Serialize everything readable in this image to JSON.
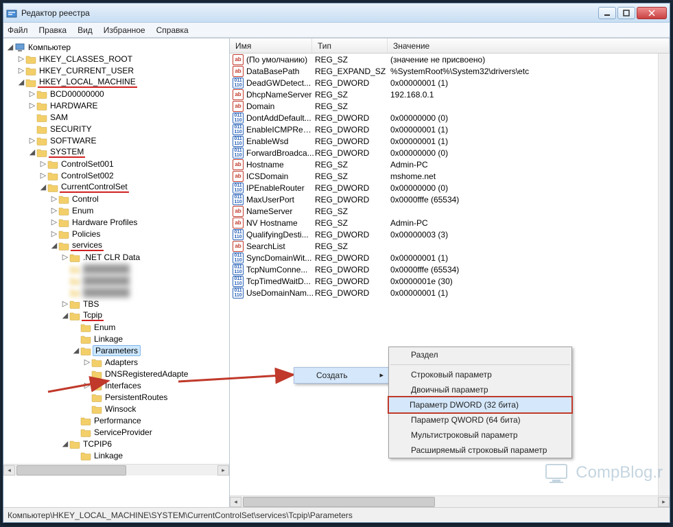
{
  "window": {
    "title": "Редактор реестра"
  },
  "menu": {
    "file": "Файл",
    "edit": "Правка",
    "view": "Вид",
    "fav": "Избранное",
    "help": "Справка"
  },
  "cols": {
    "name": "Имя",
    "type": "Тип",
    "value": "Значение"
  },
  "tree_root": "Компьютер",
  "hives": {
    "hkcr": "HKEY_CLASSES_ROOT",
    "hkcu": "HKEY_CURRENT_USER",
    "hklm": "HKEY_LOCAL_MACHINE"
  },
  "hklm_children": [
    "BCD00000000",
    "HARDWARE",
    "SAM",
    "SECURITY",
    "SOFTWARE",
    "SYSTEM"
  ],
  "system_children": [
    "ControlSet001",
    "ControlSet002",
    "CurrentControlSet"
  ],
  "ccs_children": [
    "Control",
    "Enum",
    "Hardware Profiles",
    "Policies",
    "services"
  ],
  "services_children": [
    ".NET CLR Data"
  ],
  "blurred": [
    "",
    "",
    ""
  ],
  "services_more": [
    "TBS",
    "Tcpip"
  ],
  "tcpip_children": [
    "Enum",
    "Linkage",
    "Parameters"
  ],
  "params_children": [
    "Adapters",
    "DNSRegisteredAdapte",
    "Interfaces",
    "PersistentRoutes",
    "Winsock"
  ],
  "tcpip_more": [
    "Performance",
    "ServiceProvider"
  ],
  "tcpip6": "TCPIP6",
  "tcpip6_children": [
    "Linkage"
  ],
  "values": [
    {
      "n": "(По умолчанию)",
      "t": "REG_SZ",
      "v": "(значение не присвоено)",
      "k": "ab"
    },
    {
      "n": "DataBasePath",
      "t": "REG_EXPAND_SZ",
      "v": "%SystemRoot%\\System32\\drivers\\etc",
      "k": "ab"
    },
    {
      "n": "DeadGWDetect...",
      "t": "REG_DWORD",
      "v": "0x00000001 (1)",
      "k": "bin"
    },
    {
      "n": "DhcpNameServer",
      "t": "REG_SZ",
      "v": "192.168.0.1",
      "k": "ab"
    },
    {
      "n": "Domain",
      "t": "REG_SZ",
      "v": "",
      "k": "ab"
    },
    {
      "n": "DontAddDefault...",
      "t": "REG_DWORD",
      "v": "0x00000000 (0)",
      "k": "bin"
    },
    {
      "n": "EnableICMPRedi...",
      "t": "REG_DWORD",
      "v": "0x00000001 (1)",
      "k": "bin"
    },
    {
      "n": "EnableWsd",
      "t": "REG_DWORD",
      "v": "0x00000001 (1)",
      "k": "bin"
    },
    {
      "n": "ForwardBroadca...",
      "t": "REG_DWORD",
      "v": "0x00000000 (0)",
      "k": "bin"
    },
    {
      "n": "Hostname",
      "t": "REG_SZ",
      "v": "Admin-PC",
      "k": "ab"
    },
    {
      "n": "ICSDomain",
      "t": "REG_SZ",
      "v": "mshome.net",
      "k": "ab"
    },
    {
      "n": "IPEnableRouter",
      "t": "REG_DWORD",
      "v": "0x00000000 (0)",
      "k": "bin"
    },
    {
      "n": "MaxUserPort",
      "t": "REG_DWORD",
      "v": "0x0000fffe (65534)",
      "k": "bin"
    },
    {
      "n": "NameServer",
      "t": "REG_SZ",
      "v": "",
      "k": "ab"
    },
    {
      "n": "NV Hostname",
      "t": "REG_SZ",
      "v": "Admin-PC",
      "k": "ab"
    },
    {
      "n": "QualifyingDesti...",
      "t": "REG_DWORD",
      "v": "0x00000003 (3)",
      "k": "bin"
    },
    {
      "n": "SearchList",
      "t": "REG_SZ",
      "v": "",
      "k": "ab"
    },
    {
      "n": "SyncDomainWit...",
      "t": "REG_DWORD",
      "v": "0x00000001 (1)",
      "k": "bin"
    },
    {
      "n": "TcpNumConne...",
      "t": "REG_DWORD",
      "v": "0x0000fffe (65534)",
      "k": "bin"
    },
    {
      "n": "TcpTimedWaitD...",
      "t": "REG_DWORD",
      "v": "0x0000001e (30)",
      "k": "bin"
    },
    {
      "n": "UseDomainNam...",
      "t": "REG_DWORD",
      "v": "0x00000001 (1)",
      "k": "bin"
    }
  ],
  "context": {
    "create": "Создать",
    "sub": {
      "key": "Раздел",
      "string": "Строковый параметр",
      "binary": "Двоичный параметр",
      "dword": "Параметр DWORD (32 бита)",
      "qword": "Параметр QWORD (64 бита)",
      "multi": "Мультистроковый параметр",
      "expand": "Расширяемый строковый параметр"
    }
  },
  "status": "Компьютер\\HKEY_LOCAL_MACHINE\\SYSTEM\\CurrentControlSet\\services\\Tcpip\\Parameters",
  "watermark": "CompBlog.r"
}
